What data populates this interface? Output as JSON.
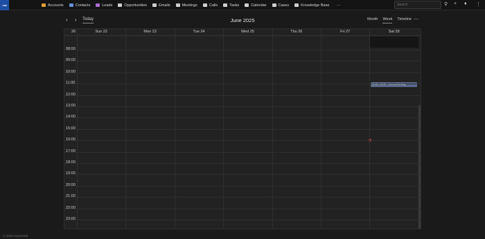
{
  "brand": {
    "logo_text": "CRM"
  },
  "nav": [
    {
      "label": "Accounts",
      "icon": "accounts-icon",
      "color": "#e0a030"
    },
    {
      "label": "Contacts",
      "icon": "contacts-icon",
      "color": "#6a8fd8"
    },
    {
      "label": "Leads",
      "icon": "leads-icon",
      "color": "#b06ad0"
    },
    {
      "label": "Opportunities",
      "icon": "dollar-icon",
      "color": "#cfcfcf"
    },
    {
      "label": "Emails",
      "icon": "email-icon",
      "color": "#cfcfcf"
    },
    {
      "label": "Meetings",
      "icon": "meetings-icon",
      "color": "#cfcfcf"
    },
    {
      "label": "Calls",
      "icon": "phone-icon",
      "color": "#cfcfcf"
    },
    {
      "label": "Tasks",
      "icon": "tasks-icon",
      "color": "#cfcfcf"
    },
    {
      "label": "Calendar",
      "icon": "calendar-icon",
      "color": "#cfcfcf"
    },
    {
      "label": "Cases",
      "icon": "cases-icon",
      "color": "#cfcfcf"
    },
    {
      "label": "Knowledge Base",
      "icon": "book-icon",
      "color": "#cfcfcf"
    }
  ],
  "nav_more": "···",
  "search": {
    "placeholder": "Search"
  },
  "calendar": {
    "today_label": "Today",
    "title": "June 2025",
    "views": [
      "Month",
      "Week",
      "Timeline"
    ],
    "active_view": "Week",
    "week_number": "26",
    "days": [
      "Sun 22",
      "Mon 23",
      "Tue 24",
      "Wed 25",
      "Thu 26",
      "Fri 27",
      "Sat 28"
    ],
    "hours": [
      "08:00",
      "09:00",
      "10:00",
      "11:00",
      "12:00",
      "13:00",
      "14:00",
      "15:00",
      "16:00",
      "17:00",
      "18:00",
      "19:00",
      "20:00",
      "21:00",
      "22:00",
      "23:00"
    ],
    "event": {
      "text": "11:00 - 11:30 · Internal Meeting",
      "color": "#5a6a8c"
    },
    "now_color": "#c0434e"
  },
  "footer": "© 2025 EspoCRM"
}
